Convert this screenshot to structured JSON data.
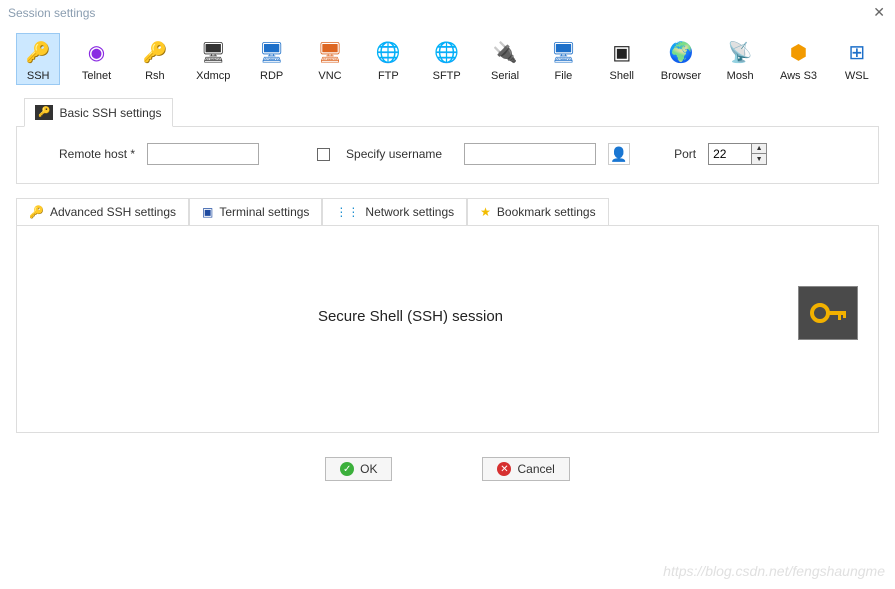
{
  "window": {
    "title": "Session settings"
  },
  "sessionTypes": [
    {
      "id": "ssh",
      "label": "SSH",
      "glyph": "🔑",
      "color": "#c39b00",
      "selected": true
    },
    {
      "id": "telnet",
      "label": "Telnet",
      "glyph": "◉",
      "color": "#8a2be2"
    },
    {
      "id": "rsh",
      "label": "Rsh",
      "glyph": "🔑",
      "color": "#d94a00"
    },
    {
      "id": "xdmcp",
      "label": "Xdmcp",
      "glyph": "🖥",
      "color": "#333"
    },
    {
      "id": "rdp",
      "label": "RDP",
      "glyph": "🖥",
      "color": "#1e70c9"
    },
    {
      "id": "vnc",
      "label": "VNC",
      "glyph": "🖥",
      "color": "#d62"
    },
    {
      "id": "ftp",
      "label": "FTP",
      "glyph": "🌐",
      "color": "#2da82d"
    },
    {
      "id": "sftp",
      "label": "SFTP",
      "glyph": "🌐",
      "color": "#e09b00"
    },
    {
      "id": "serial",
      "label": "Serial",
      "glyph": "🔌",
      "color": "#555"
    },
    {
      "id": "file",
      "label": "File",
      "glyph": "🖥",
      "color": "#1e70c9"
    },
    {
      "id": "shell",
      "label": "Shell",
      "glyph": "▣",
      "color": "#222"
    },
    {
      "id": "browser",
      "label": "Browser",
      "glyph": "🌍",
      "color": "#1e70c9"
    },
    {
      "id": "mosh",
      "label": "Mosh",
      "glyph": "📡",
      "color": "#d28a00"
    },
    {
      "id": "aws",
      "label": "Aws S3",
      "glyph": "⬢",
      "color": "#f29a00"
    },
    {
      "id": "wsl",
      "label": "WSL",
      "glyph": "⊞",
      "color": "#1e70c9"
    }
  ],
  "basicTab": {
    "label": "Basic SSH settings"
  },
  "basic": {
    "hostLabel": "Remote host *",
    "hostValue": "",
    "specifyUserLabel": "Specify username",
    "specifyUserChecked": false,
    "usernameValue": "",
    "portLabel": "Port",
    "portValue": "22"
  },
  "detailTabs": [
    {
      "id": "adv",
      "label": "Advanced SSH settings",
      "icon": "🔑",
      "icolor": "#c39b00",
      "selected": true
    },
    {
      "id": "term",
      "label": "Terminal settings",
      "icon": "▣",
      "icolor": "#1e4aa0"
    },
    {
      "id": "net",
      "label": "Network settings",
      "icon": "⋮⋮",
      "icolor": "#1e90d0"
    },
    {
      "id": "bm",
      "label": "Bookmark settings",
      "icon": "★",
      "icolor": "#f2bc00"
    }
  ],
  "main": {
    "title": "Secure Shell (SSH) session"
  },
  "buttons": {
    "ok": "OK",
    "cancel": "Cancel"
  },
  "watermark": "https://blog.csdn.net/fengshaungme"
}
